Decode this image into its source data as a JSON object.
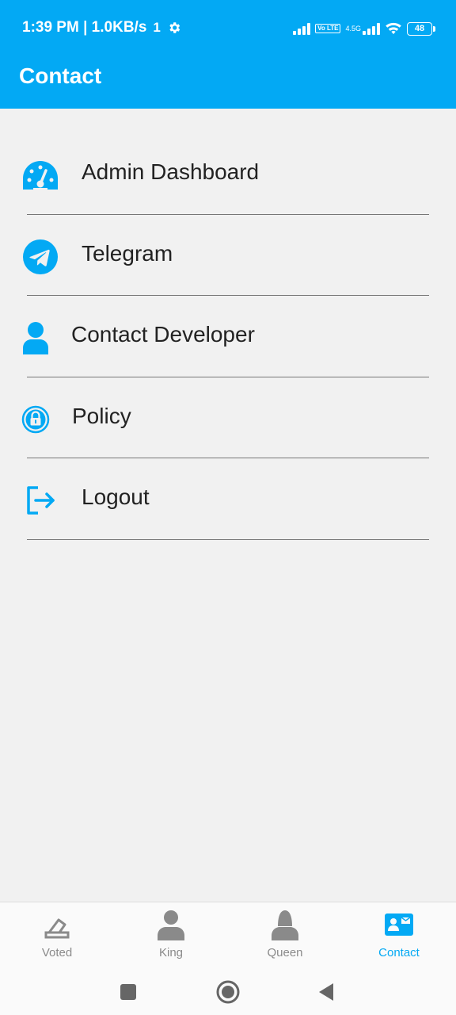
{
  "status_bar": {
    "time_speed": "1:39 PM | 1.0KB/s",
    "extra": "1",
    "network": "4.5G",
    "volte": "Vo LTE",
    "battery": "48"
  },
  "header": {
    "title": "Contact"
  },
  "menu": {
    "items": [
      {
        "label": "Admin Dashboard",
        "icon": "dashboard-gauge-icon"
      },
      {
        "label": "Telegram",
        "icon": "telegram-icon"
      },
      {
        "label": "Contact Developer",
        "icon": "person-icon"
      },
      {
        "label": "Policy",
        "icon": "lock-icon"
      },
      {
        "label": "Logout",
        "icon": "logout-icon"
      }
    ]
  },
  "bottom_nav": {
    "items": [
      {
        "label": "Voted",
        "icon": "ballot-box-icon",
        "active": false
      },
      {
        "label": "King",
        "icon": "king-person-icon",
        "active": false
      },
      {
        "label": "Queen",
        "icon": "queen-person-icon",
        "active": false
      },
      {
        "label": "Contact",
        "icon": "contact-card-icon",
        "active": true
      }
    ]
  },
  "colors": {
    "accent": "#03a9f4",
    "background": "#f1f1f1",
    "inactive": "#8a8a8a"
  }
}
